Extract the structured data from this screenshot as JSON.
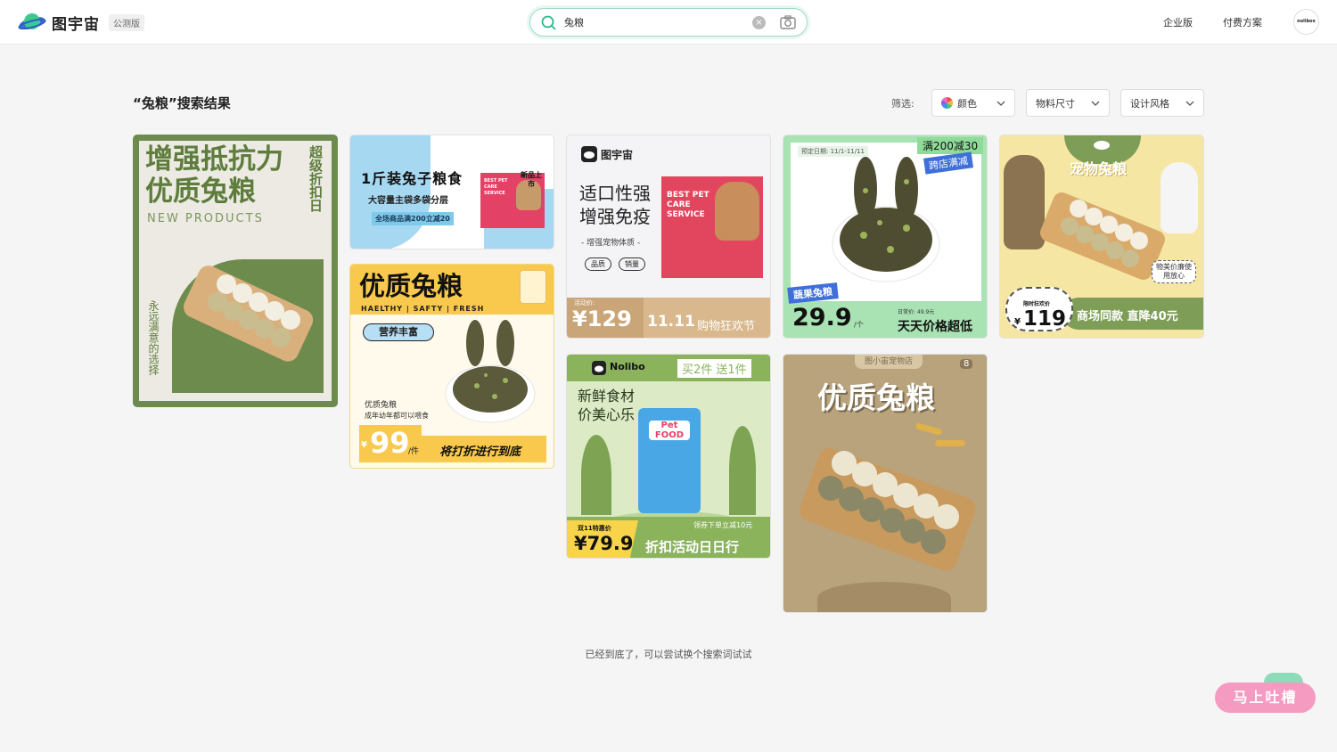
{
  "header": {
    "logo_text": "图宇宙",
    "beta_badge": "公测版",
    "search_value": "兔粮",
    "nav": {
      "enterprise": "企业版",
      "pricing": "付费方案"
    },
    "avatar_text": "nolibox"
  },
  "results": {
    "title": "“兔粮”搜索结果",
    "filter_label": "筛选:",
    "filters": [
      "颜色",
      "物料尺寸",
      "设计风格"
    ]
  },
  "cards": [
    {
      "line1": "增强抵抗力",
      "line2": "优质兔粮",
      "sub": "NEW PRODUCTS",
      "side": "超级折扣日",
      "side2": "永远满意的选择"
    },
    {
      "line1": "1斤装兔子粮食",
      "line2": "大容量主袋多袋分层",
      "promo": "全场商品满200立减20",
      "tag": "新品上市",
      "badge": "BEST PET CARE SERVICE"
    },
    {
      "title": "优质兔粮",
      "sub": "HAELTHY | SAFTY | FRESH",
      "pill": "营养丰富",
      "desc1": "优质兔粮",
      "desc2": "成年幼年都可以喂食",
      "price": "99",
      "unit": "/件",
      "currency": "¥",
      "cta": "将打折进行到底"
    },
    {
      "logo": "图宇宙",
      "line1": "适口性强",
      "line2": "增强免疫",
      "sub": "- 增强宠物体质 -",
      "tag1": "品质",
      "tag2": "销量",
      "badge": "BEST PET CARE SERVICE",
      "price_label": "活动价:",
      "price": "¥129",
      "event": "11.11",
      "event_text": "购物狂欢节"
    },
    {
      "logo": "Nolibo",
      "promo": "买2件 送1件",
      "line1": "新鲜食材",
      "line2": "价美心乐",
      "pack": "Pet FOOD",
      "coupon": "领券下单立减10元",
      "price_label": "双11特惠价",
      "price": "¥79.9",
      "cta": "折扣活动日日行"
    },
    {
      "date": "预定日期: 11/1-11/11",
      "promo1": "满200减30",
      "promo2": "跨店满减",
      "tag": "蔬果兔粮",
      "price": "29.9",
      "unit": "/个",
      "orig": "日常价: 49.9元",
      "cta": "天天价格超低"
    },
    {
      "title": "优质兔粮",
      "shop": "图小宙宠物店",
      "count": "8"
    },
    {
      "title": "宠物兔粮",
      "bubble": "物美价廉使用放心",
      "price_label": "限时狂欢价",
      "price": "119",
      "currency": "¥",
      "cta": "商场同款 直降40元"
    }
  ],
  "footer": {
    "end_text": "已经到底了，可以尝试换个搜索词试试",
    "feedback": "马上吐槽"
  },
  "colors": {
    "accent": "#2db88a",
    "olive": "#6b8a4a",
    "yellow": "#f6c84a",
    "pink": "#f59ac0"
  }
}
